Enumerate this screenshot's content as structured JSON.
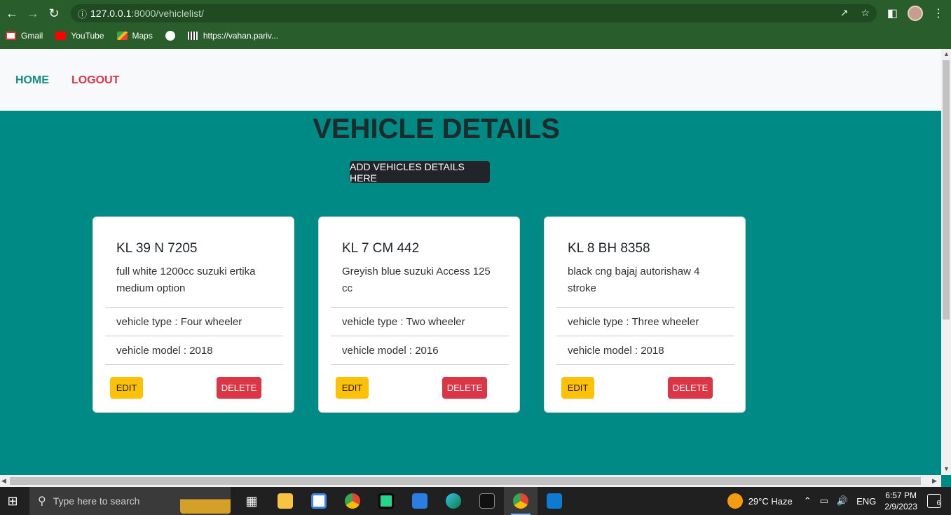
{
  "browser": {
    "url_host": "127.0.0.1",
    "url_rest": ":8000/vehiclelist/",
    "bookmarks": [
      {
        "label": "Gmail",
        "icon": "gmail-icon"
      },
      {
        "label": "YouTube",
        "icon": "youtube-icon"
      },
      {
        "label": "Maps",
        "icon": "maps-icon"
      },
      {
        "label": "",
        "icon": "globe-icon"
      },
      {
        "label": "https://vahan.pariv...",
        "icon": "qr-icon"
      }
    ]
  },
  "nav": {
    "home": "HOME",
    "logout": "LOGOUT"
  },
  "page": {
    "title": "VEHICLE DETAILS",
    "add_button": "ADD VEHICLES DETAILS HERE"
  },
  "vehicles": [
    {
      "reg": "KL 39 N 7205",
      "desc": "full white 1200cc suzuki ertika medium option",
      "type": "vehicle type : Four wheeler",
      "model": "vehicle model : 2018",
      "edit": "EDIT",
      "delete": "DELETE"
    },
    {
      "reg": "KL 7 CM 442",
      "desc": "Greyish blue suzuki Access 125 cc",
      "type": "vehicle type : Two wheeler",
      "model": "vehicle model : 2016",
      "edit": "EDIT",
      "delete": "DELETE"
    },
    {
      "reg": "KL 8 BH 8358",
      "desc": "black cng bajaj autorishaw 4 stroke",
      "type": "vehicle type : Three wheeler",
      "model": "vehicle model : 2018",
      "edit": "EDIT",
      "delete": "DELETE"
    }
  ],
  "taskbar": {
    "search_placeholder": "Type here to search",
    "weather": "29°C  Haze",
    "lang": "ENG",
    "time": "6:57 PM",
    "date": "2/9/2023",
    "notifications": "6"
  },
  "colors": {
    "page_bg": "#008a85",
    "home": "#138a85",
    "logout": "#dc3545",
    "edit": "#ffc107",
    "delete": "#dc3545"
  }
}
